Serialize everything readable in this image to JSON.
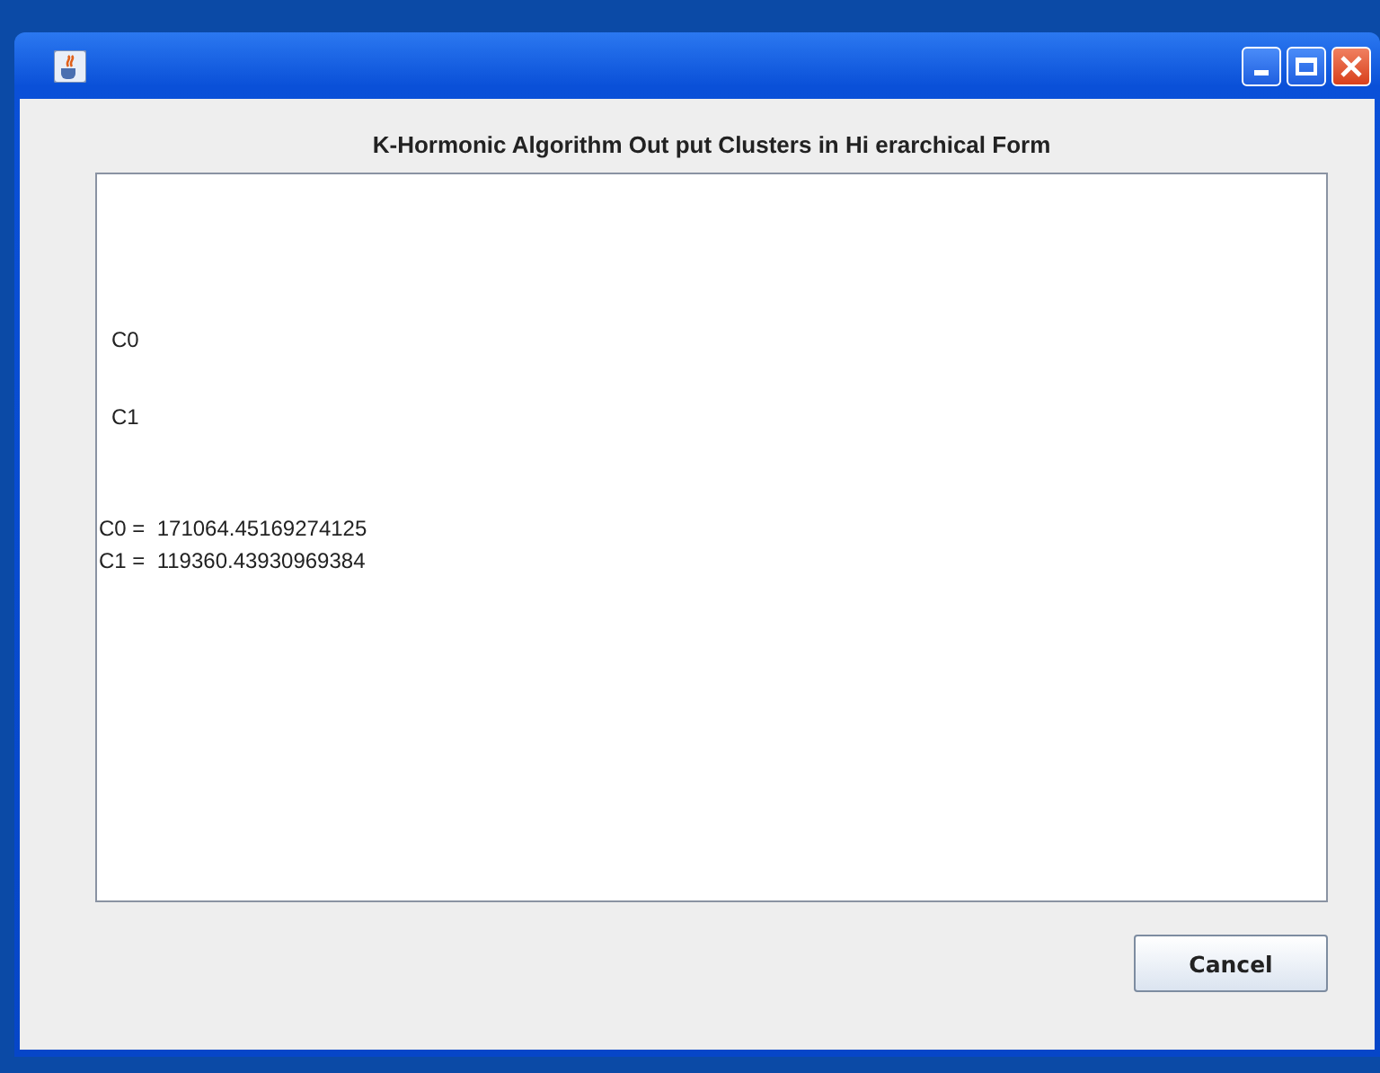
{
  "window": {
    "title_bar_buttons": [
      {
        "kind": "minimize"
      },
      {
        "kind": "maximize"
      },
      {
        "kind": "close"
      }
    ]
  },
  "heading": "K-Hormonic Algorithm Out put Clusters in Hi erarchical Form",
  "clusters": [
    "C0",
    "C1"
  ],
  "values": [
    "C0 =  171064.45169274125",
    "C1 =  119360.43930969384"
  ],
  "buttons": [
    "Cancel"
  ]
}
